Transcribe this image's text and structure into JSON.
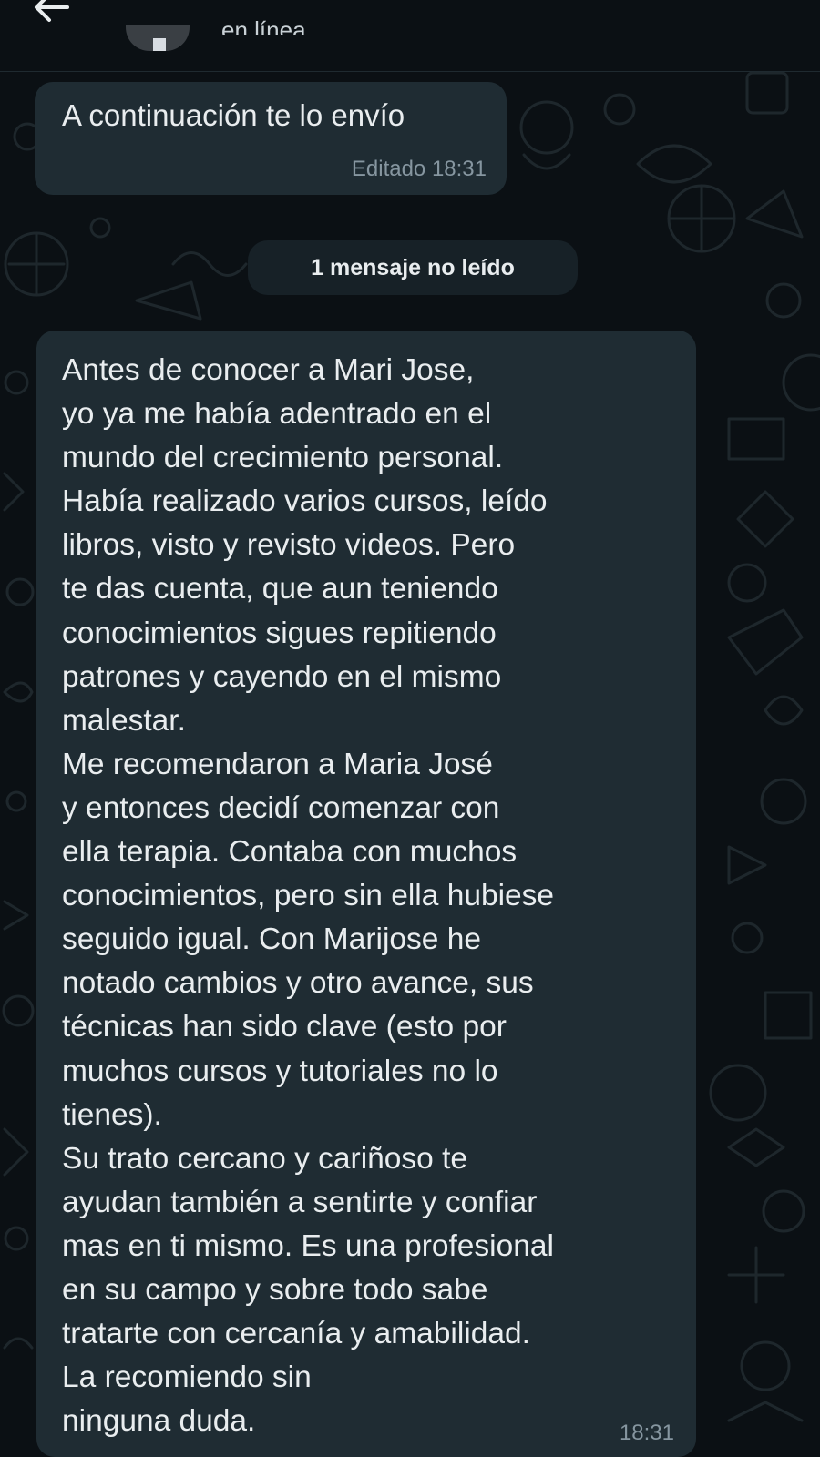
{
  "header": {
    "back_icon": "arrow-left-icon",
    "status": "en línea"
  },
  "messages": [
    {
      "text": "A continuación te lo envío",
      "meta": "Editado 18:31"
    },
    {
      "lines": [
        "Antes de conocer a Mari Jose,",
        "yo ya me había adentrado en el",
        "mundo del crecimiento personal.",
        "Había realizado varios cursos, leído",
        "libros, visto y revisto videos. Pero",
        "te das cuenta, que aun teniendo",
        "conocimientos sigues repitiendo",
        "patrones y cayendo en el mismo",
        "malestar.",
        "Me recomendaron a Maria José",
        "y entonces decidí comenzar con",
        "ella terapia. Contaba con muchos",
        "conocimientos, pero sin ella hubiese",
        "seguido igual. Con Marijose he",
        "notado cambios y otro avance, sus",
        "técnicas han sido clave (esto por",
        "muchos cursos y tutoriales no lo",
        "tienes).",
        "Su trato cercano y cariñoso te",
        "ayudan también a sentirte y confiar",
        "mas en ti mismo. Es una profesional",
        "en su campo y sobre todo sabe",
        "tratarte con cercanía y amabilidad.",
        "La recomiendo sin",
        "ninguna duda."
      ],
      "time": "18:31"
    }
  ],
  "unread_divider": "1 mensaje no leído",
  "colors": {
    "background": "#0b1014",
    "bubble_incoming": "#1f2c33",
    "text_primary": "#e9edef",
    "text_meta": "#8696a0"
  }
}
